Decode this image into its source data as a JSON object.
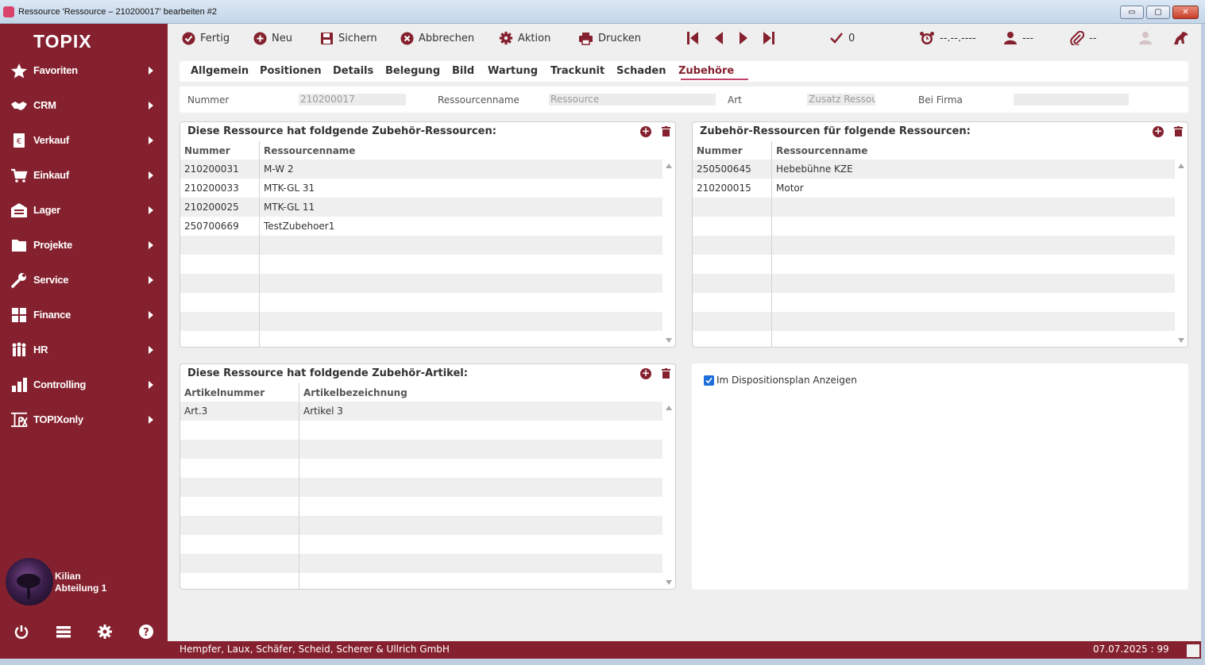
{
  "window": {
    "title": "Ressource 'Ressource – 210200017' bearbeiten #2",
    "min_glyph": "▭",
    "max_glyph": "▢",
    "close_glyph": "✕"
  },
  "sidebar": {
    "logo": "TOPIX",
    "items": [
      {
        "label": "Favoriten",
        "icon": "star-icon"
      },
      {
        "label": "CRM",
        "icon": "handshake-icon"
      },
      {
        "label": "Verkauf",
        "icon": "euro-document-icon"
      },
      {
        "label": "Einkauf",
        "icon": "cart-icon"
      },
      {
        "label": "Lager",
        "icon": "warehouse-icon"
      },
      {
        "label": "Projekte",
        "icon": "folder-icon"
      },
      {
        "label": "Service",
        "icon": "wrench-icon"
      },
      {
        "label": "Finance",
        "icon": "calculator-icon"
      },
      {
        "label": "HR",
        "icon": "people-icon"
      },
      {
        "label": "Controlling",
        "icon": "bar-chart-icon"
      },
      {
        "label": "TOPIXonly",
        "icon": "tpx-icon"
      }
    ],
    "user": {
      "name": "Kilian",
      "department": "Abteilung 1"
    },
    "footer_icons": [
      "power-icon",
      "list-icon",
      "gear-icon",
      "help-icon"
    ]
  },
  "toolbar": {
    "fertig": "Fertig",
    "neu": "Neu",
    "sichern": "Sichern",
    "abbrechen": "Abbrechen",
    "aktion": "Aktion",
    "drucken": "Drucken",
    "check_count": "0",
    "date_placeholder": "--.--.----",
    "user_placeholder": "---",
    "attach_placeholder": "--"
  },
  "tabs": [
    "Allgemein",
    "Positionen",
    "Details",
    "Belegung",
    "Bild",
    "Wartung",
    "Trackunit",
    "Schaden",
    "Zubehöre"
  ],
  "active_tab": "Zubehöre",
  "fields": {
    "nummer_label": "Nummer",
    "nummer_value": "210200017",
    "name_label": "Ressourcenname",
    "name_value": "Ressource",
    "art_label": "Art",
    "art_value": "Zusatz Ressou",
    "firma_label": "Bei Firma",
    "firma_value": ""
  },
  "panel_resources": {
    "title": "Diese Ressource hat foldgende Zubehör-Ressourcen:",
    "columns": [
      "Nummer",
      "Ressourcenname"
    ],
    "rows": [
      [
        "210200031",
        "M-W 2"
      ],
      [
        "210200033",
        "MTK-GL 31"
      ],
      [
        "210200025",
        "MTK-GL 11"
      ],
      [
        "250700669",
        "TestZubehoer1"
      ]
    ]
  },
  "panel_parents": {
    "title": "Zubehör-Ressourcen für folgende Ressourcen:",
    "columns": [
      "Nummer",
      "Ressourcenname"
    ],
    "rows": [
      [
        "250500645",
        "Hebebühne KZE"
      ],
      [
        "210200015",
        "Motor"
      ]
    ]
  },
  "panel_articles": {
    "title": "Diese Ressource hat foldgende Zubehör-Artikel:",
    "columns": [
      "Artikelnummer",
      "Artikelbezeichnung"
    ],
    "rows": [
      [
        "Art.3",
        "Artikel 3"
      ]
    ]
  },
  "dispo": {
    "label": "Im Dispositionsplan Anzeigen",
    "checked": true
  },
  "statusbar": {
    "company": "Hempfer, Laux, Schäfer, Scheid, Scherer & Ullrich GmbH",
    "date": "07.07.2025 : 99"
  },
  "colors": {
    "brand": "#85212e",
    "accent": "#c2416a",
    "checkbox": "#1e6fd9"
  }
}
